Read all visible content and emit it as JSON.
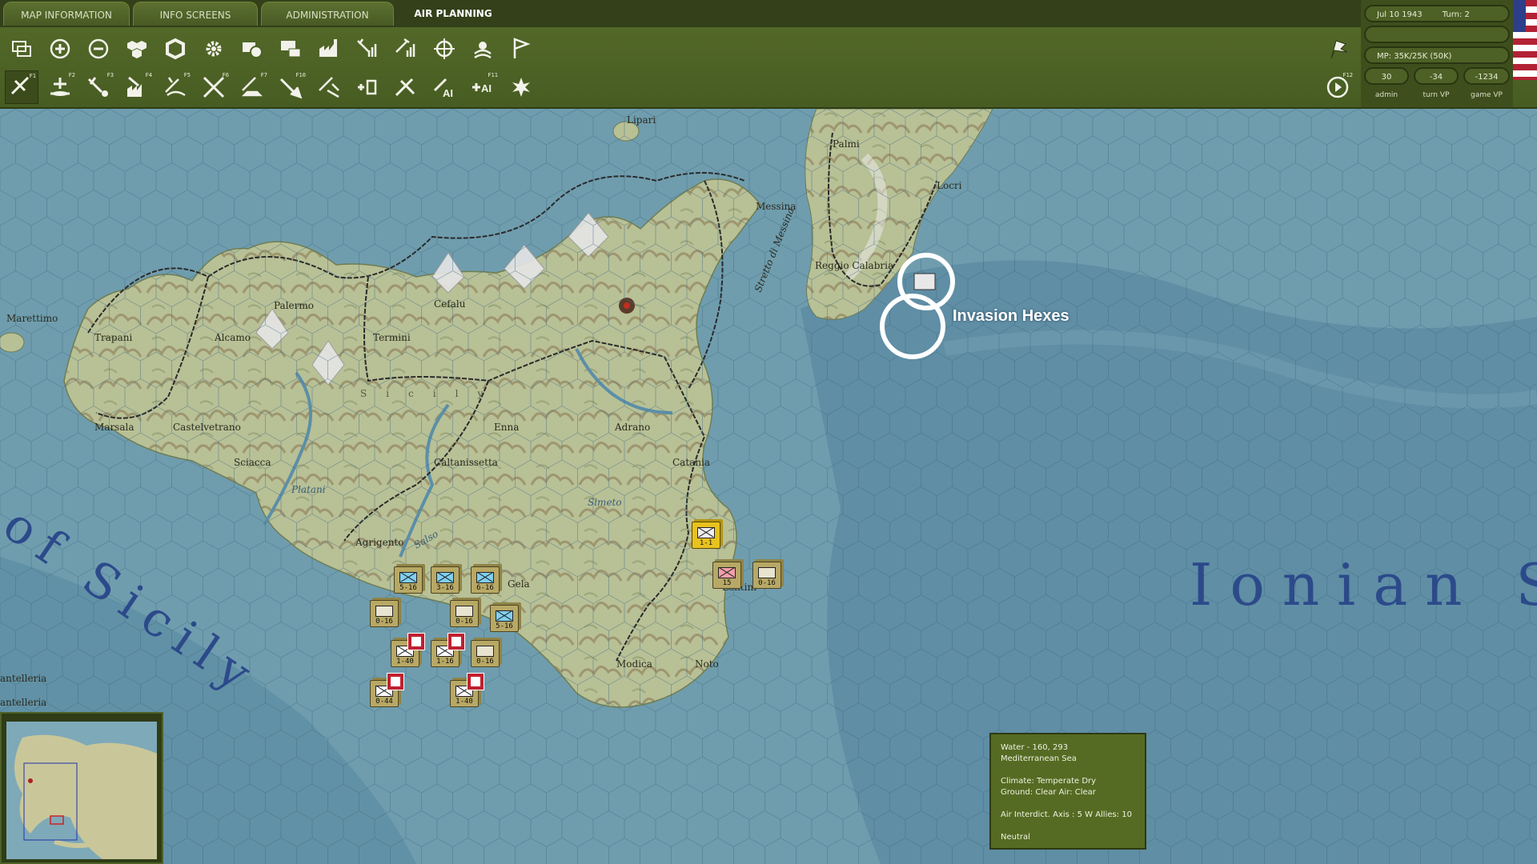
{
  "tabs": [
    {
      "label": "MAP INFORMATION"
    },
    {
      "label": "INFO SCREENS"
    },
    {
      "label": "ADMINISTRATION"
    },
    {
      "label": "AIR PLANNING"
    }
  ],
  "toolbar_row1_icons": [
    "windows-icon",
    "zoom-in-icon",
    "zoom-out-icon",
    "hex-cluster-icon",
    "hex-frame-icon",
    "gear-icon",
    "unit-box-icon",
    "supply-depot-icon",
    "factory-icon",
    "air-strength-icon",
    "air-transfer-icon",
    "air-target-icon",
    "weather-icon",
    "flag-icon"
  ],
  "toolbar_row2_icons": [
    "air-mission-icon",
    "airfield-icon",
    "ground-attack-icon",
    "city-bomb-icon",
    "naval-patrol-icon",
    "interdiction-icon",
    "port-attack-icon",
    "air-transport-icon",
    "recon-icon",
    "supply-drop-icon",
    "fighter-sweep-icon",
    "ai-air-icon",
    "ai-plus-icon",
    "explosion-icon"
  ],
  "row2_fkeys": [
    "F1",
    "F2",
    "F3",
    "F4",
    "F5",
    "F6",
    "F7",
    "F10",
    "",
    "",
    "",
    "",
    "F11",
    ""
  ],
  "status": {
    "date": "Jul 10 1943",
    "turn": "Turn: 2",
    "mp": "MP: 35K/25K (50K)",
    "admin_value": "30",
    "turn_vp_value": "-34",
    "game_vp_value": "-1234",
    "admin_label": "admin",
    "turn_vp_label": "turn VP",
    "game_vp_label": "game VP",
    "fkey_right": "F12"
  },
  "map": {
    "sea_main": "Ionian Se",
    "sea_gulf": "of Sicily",
    "island_label": "Sicily",
    "strait": "Stretto di Messina",
    "places": [
      "Lipari",
      "Palmi",
      "Messina",
      "Reggio Calabria",
      "Marettimo",
      "Trapani",
      "Palermo",
      "Cefalu",
      "Alcamo",
      "Termini",
      "Marsala",
      "Castelvetrano",
      "Enna",
      "Adrano",
      "Sciacca",
      "Caltanissetta",
      "Catania",
      "Platani",
      "Simeto",
      "Agrigento",
      "Salso",
      "Modica",
      "Noto",
      "antelleria",
      "antelleria",
      "Gela",
      "Lentini",
      "Locri"
    ]
  },
  "annotation": {
    "label": "Invasion Hexes"
  },
  "units": [
    {
      "str": "5-16",
      "type": "inf"
    },
    {
      "str": "3-16",
      "type": "inf"
    },
    {
      "str": "6-16",
      "type": "inf"
    },
    {
      "str": "0-16",
      "type": "plane"
    },
    {
      "str": "0-16",
      "type": "plane"
    },
    {
      "str": "5-16",
      "type": "inf"
    },
    {
      "str": "1-40",
      "type": "flag"
    },
    {
      "str": "1-16",
      "type": "flag"
    },
    {
      "str": "0-16",
      "type": "plane"
    },
    {
      "str": "0-44",
      "type": "flag"
    },
    {
      "str": "1-40",
      "type": "flag"
    },
    {
      "str": "1-1",
      "type": "yellow"
    },
    {
      "str": "15",
      "type": "axis"
    },
    {
      "str": "0-16",
      "type": "plane"
    }
  ],
  "info_box": {
    "line1": "Water - 160, 293",
    "line2": "Mediterranean Sea",
    "line3": "Climate: Temperate Dry",
    "line4": "Ground: Clear  Air: Clear",
    "line5": "Air Interdict. Axis : 5   W Allies: 10",
    "line6": "Neutral"
  },
  "colors": {
    "ui_green": "#566c2a",
    "sea": "#5d8ea3",
    "land": "#b9c29a",
    "allied_counter": "#b8a865",
    "axis_counter": "#e8c21f"
  }
}
